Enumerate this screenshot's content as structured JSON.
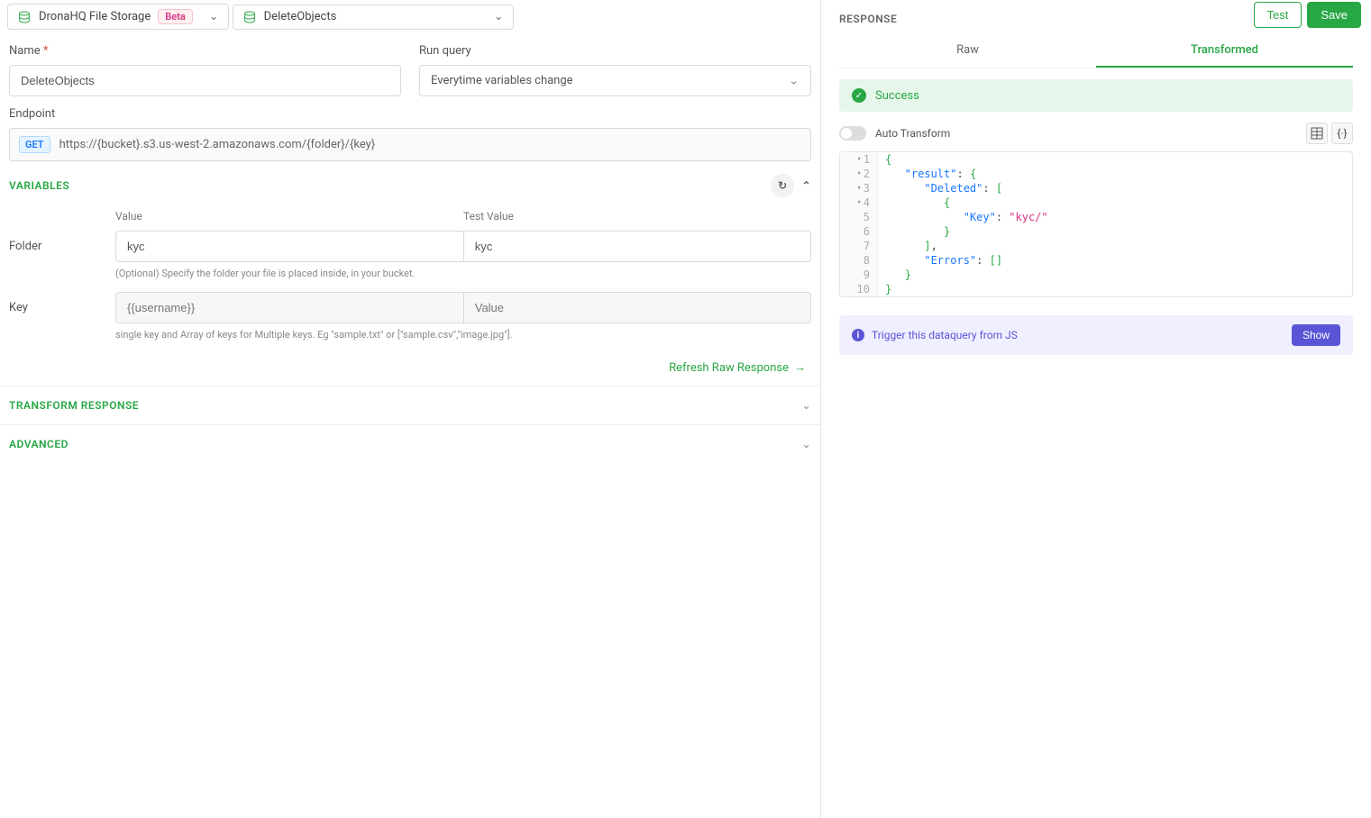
{
  "topbar": {
    "storage_label": "DronaHQ File Storage",
    "beta": "Beta",
    "action_label": "DeleteObjects",
    "test": "Test",
    "save": "Save"
  },
  "form": {
    "name_label": "Name",
    "name_value": "DeleteObjects",
    "runquery_label": "Run query",
    "runquery_value": "Everytime variables change",
    "endpoint_label": "Endpoint",
    "method": "GET",
    "endpoint_url": "https://{bucket}.s3.us-west-2.amazonaws.com/{folder}/{key}"
  },
  "variables": {
    "title": "VARIABLES",
    "value_header": "Value",
    "test_header": "Test Value",
    "rows": [
      {
        "label": "Folder",
        "value": "kyc",
        "test": "kyc",
        "hint": "(Optional) Specify the folder your file is placed inside, in your bucket."
      },
      {
        "label": "Key",
        "value_placeholder": "{{username}}",
        "test_placeholder": "Value",
        "hint": "single key and Array of keys for Multiple keys. Eg \"sample.txt\" or [\"sample.csv\",\"image.jpg\"]."
      }
    ],
    "refresh_link": "Refresh Raw Response"
  },
  "sections": {
    "transform": "TRANSFORM RESPONSE",
    "advanced": "ADVANCED"
  },
  "response": {
    "title": "RESPONSE",
    "tabs": {
      "raw": "Raw",
      "transformed": "Transformed"
    },
    "success": "Success",
    "auto_transform": "Auto Transform",
    "code_lines": [
      {
        "n": 1,
        "fold": true,
        "text_html": "<span class='brace'>{</span>"
      },
      {
        "n": 2,
        "fold": true,
        "text_html": "   <span class='key'>\"result\"</span>: <span class='brace'>{</span>"
      },
      {
        "n": 3,
        "fold": true,
        "text_html": "      <span class='key'>\"Deleted\"</span>: <span class='brace'>[</span>"
      },
      {
        "n": 4,
        "fold": true,
        "text_html": "         <span class='brace'>{</span>"
      },
      {
        "n": 5,
        "fold": false,
        "text_html": "            <span class='key'>\"Key\"</span>: <span class='str'>\"kyc/\"</span>"
      },
      {
        "n": 6,
        "fold": false,
        "text_html": "         <span class='brace'>}</span>"
      },
      {
        "n": 7,
        "fold": false,
        "text_html": "      <span class='brace'>]</span>,"
      },
      {
        "n": 8,
        "fold": false,
        "text_html": "      <span class='key'>\"Errors\"</span>: <span class='brace'>[]</span>"
      },
      {
        "n": 9,
        "fold": false,
        "text_html": "   <span class='brace'>}</span>"
      },
      {
        "n": 10,
        "fold": false,
        "text_html": "<span class='brace'>}</span>"
      }
    ],
    "trigger_text": "Trigger this dataquery from JS",
    "show": "Show"
  }
}
